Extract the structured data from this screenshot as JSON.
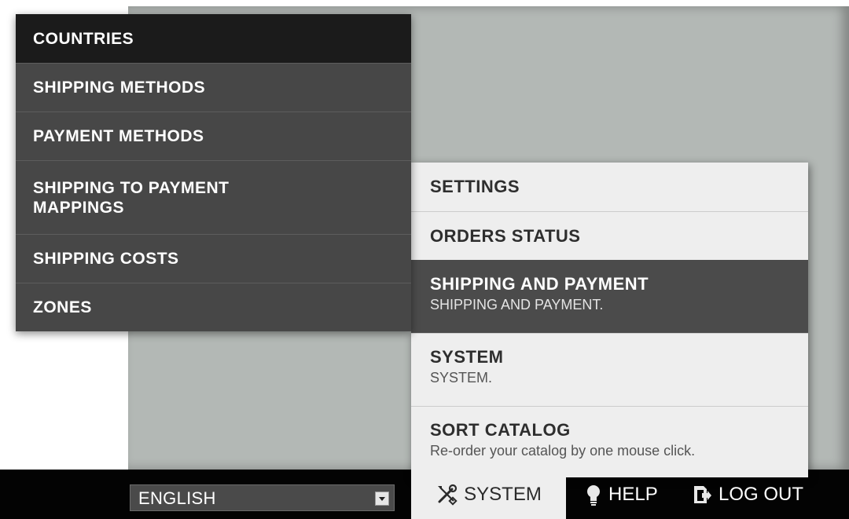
{
  "submenu": {
    "items": [
      {
        "label": "COUNTRIES"
      },
      {
        "label": "SHIPPING METHODS"
      },
      {
        "label": "PAYMENT METHODS"
      },
      {
        "label": "SHIPPING TO PAYMENT MAPPINGS"
      },
      {
        "label": "SHIPPING COSTS"
      },
      {
        "label": "ZONES"
      }
    ]
  },
  "mainmenu": {
    "items": [
      {
        "label": "SETTINGS"
      },
      {
        "label": "ORDERS STATUS"
      },
      {
        "label": "SHIPPING AND PAYMENT",
        "desc": "SHIPPING AND PAYMENT.",
        "active": true
      },
      {
        "label": "SYSTEM",
        "desc": "SYSTEM."
      },
      {
        "label": "SORT CATALOG",
        "desc": "Re-order your catalog by one mouse click."
      }
    ]
  },
  "bottombar": {
    "language": {
      "selected": "ENGLISH"
    },
    "system": {
      "label": "SYSTEM",
      "icon": "tools-icon"
    },
    "help": {
      "label": "HELP",
      "icon": "lightbulb-icon"
    },
    "logout": {
      "label": "LOG OUT",
      "icon": "logout-icon"
    }
  },
  "colors": {
    "background_panel": "#b3b8b5",
    "submenu_bg": "#474747",
    "submenu_first_bg": "#1b1b1b",
    "mainmenu_bg": "#eeeeee",
    "mainmenu_active_bg": "#4b4b4b",
    "bar_bg": "#030303"
  }
}
